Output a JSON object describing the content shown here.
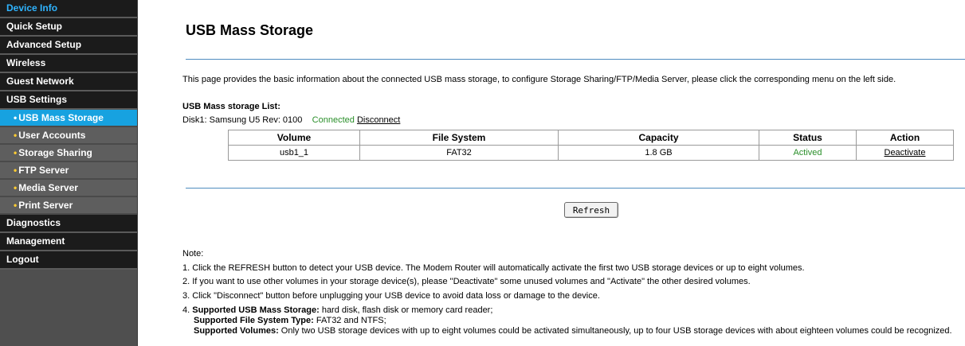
{
  "sidebar": {
    "top_items": [
      {
        "label": "Device Info"
      },
      {
        "label": "Quick Setup"
      },
      {
        "label": "Advanced Setup"
      },
      {
        "label": "Wireless"
      },
      {
        "label": "Guest Network"
      },
      {
        "label": "USB Settings"
      }
    ],
    "usb_sub_items": [
      {
        "label": "USB Mass Storage"
      },
      {
        "label": "User Accounts"
      },
      {
        "label": "Storage Sharing"
      },
      {
        "label": "FTP Server"
      },
      {
        "label": "Media Server"
      },
      {
        "label": "Print Server"
      }
    ],
    "bottom_items": [
      {
        "label": "Diagnostics"
      },
      {
        "label": "Management"
      },
      {
        "label": "Logout"
      }
    ],
    "bullet": "•",
    "colors": {
      "selected_bg": "#17a2e0",
      "active_text": "#2fb4ff",
      "bullet": "#ffcc33"
    }
  },
  "main": {
    "title": "USB Mass Storage",
    "description": "This page provides the basic information about the connected USB mass storage, to configure Storage Sharing/FTP/Media Server, please click the corresponding menu on the left side.",
    "list_heading": "USB Mass storage List:",
    "disk": {
      "label": "Disk1: Samsung U5 Rev: 0100",
      "status": "Connected",
      "disconnect_label": "Disconnect"
    },
    "table": {
      "headers": [
        "Volume",
        "File System",
        "Capacity",
        "Status",
        "Action"
      ],
      "rows": [
        {
          "volume": "usb1_1",
          "file_system": "FAT32",
          "capacity": "1.8 GB",
          "status": "Actived",
          "action": "Deactivate"
        }
      ]
    },
    "refresh_label": "Refresh",
    "note": {
      "heading": "Note:",
      "lines": [
        "1. Click the REFRESH button to detect your USB device. The Modem Router will automatically activate the first two USB storage devices or up to eight volumes.",
        "2. If you want to use other volumes in your storage device(s), please \"Deactivate\" some unused volumes and \"Activate\" the other desired volumes.",
        "3. Click \"Disconnect\" button before unplugging your USB device to avoid data loss or damage to the device."
      ],
      "item4": {
        "prefix": "4. ",
        "storage_label": "Supported USB Mass Storage:",
        "storage_value": " hard disk, flash disk or memory card reader;",
        "fs_label": "Supported File System Type:",
        "fs_value": " FAT32 and NTFS;",
        "volumes_label": "Supported Volumes:",
        "volumes_value": " Only two USB storage devices with up to eight volumes could be activated simultaneously, up to four USB storage devices with about eighteen volumes could be recognized."
      }
    }
  }
}
